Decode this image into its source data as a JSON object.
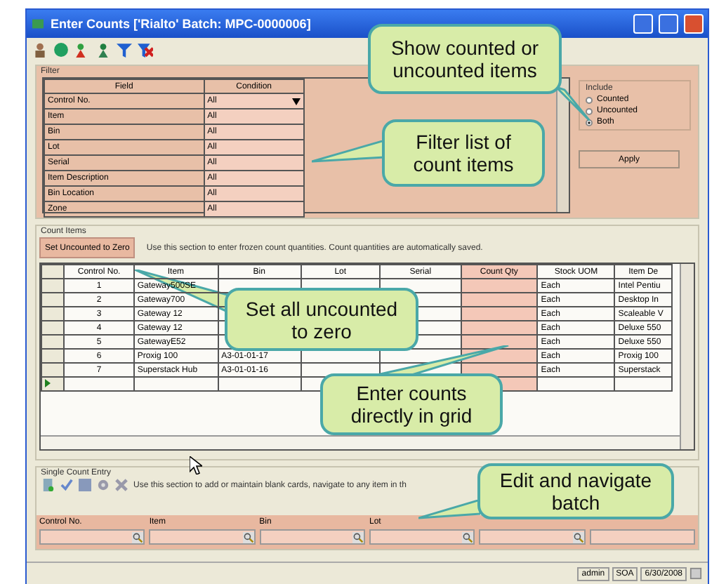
{
  "window": {
    "title": "Enter Counts ['Rialto' Batch: MPC-0000006]"
  },
  "filter": {
    "title": "Filter",
    "columns": [
      "Field",
      "Condition"
    ],
    "rows": [
      {
        "field": "Control No.",
        "condition": "All",
        "dropdown": true
      },
      {
        "field": "Item",
        "condition": "All",
        "dropdown": false
      },
      {
        "field": "Bin",
        "condition": "All",
        "dropdown": false
      },
      {
        "field": "Lot",
        "condition": "All",
        "dropdown": false
      },
      {
        "field": "Serial",
        "condition": "All",
        "dropdown": false
      },
      {
        "field": "Item Description",
        "condition": "All",
        "dropdown": false
      },
      {
        "field": "Bin Location",
        "condition": "All",
        "dropdown": false
      },
      {
        "field": "Zone",
        "condition": "All",
        "dropdown": false
      }
    ],
    "include": {
      "title": "Include",
      "options": [
        {
          "label": "Counted",
          "selected": false
        },
        {
          "label": "Uncounted",
          "selected": false
        },
        {
          "label": "Both",
          "selected": true
        }
      ]
    },
    "apply_button": "Apply"
  },
  "count_items": {
    "title": "Count Items",
    "button": "Set Uncounted to Zero",
    "hint": "Use this section to enter frozen count quantities. Count quantities are automatically saved.",
    "columns": [
      "Control No.",
      "Item",
      "Bin",
      "Lot",
      "Serial",
      "Count Qty",
      "Stock UOM",
      "Item De"
    ],
    "rows": [
      [
        "1",
        "Gateway500SE",
        "",
        "",
        "",
        "",
        "Each",
        "Intel Pentiu"
      ],
      [
        "2",
        "Gateway700",
        "",
        "",
        "",
        "",
        "Each",
        "Desktop In"
      ],
      [
        "3",
        "Gateway 12",
        "",
        "",
        "",
        "",
        "Each",
        "Scaleable V"
      ],
      [
        "4",
        "Gateway 12",
        "",
        "",
        "",
        "",
        "Each",
        "Deluxe 550"
      ],
      [
        "5",
        "GatewayE52",
        "",
        "",
        "",
        "",
        "Each",
        "Deluxe 550"
      ],
      [
        "6",
        "Proxig 100",
        "A3-01-01-17",
        "",
        "",
        "",
        "Each",
        "Proxig 100"
      ],
      [
        "7",
        "Superstack Hub",
        "A3-01-01-16",
        "",
        "",
        "",
        "Each",
        "Superstack"
      ]
    ]
  },
  "single_entry": {
    "title": "Single Count Entry",
    "hint": "Use this section to add or maintain blank cards, navigate to any item in th",
    "fields": [
      {
        "label": "Control No.",
        "lookup": true
      },
      {
        "label": "Item",
        "lookup": true
      },
      {
        "label": "Bin",
        "lookup": true
      },
      {
        "label": "Lot",
        "lookup": true
      },
      {
        "lookup": true
      },
      {
        "lookup": false
      }
    ]
  },
  "status_bar": [
    "admin",
    "SOA",
    "6/30/2008"
  ],
  "callouts": [
    {
      "text": "Show counted or uncounted items"
    },
    {
      "text": "Filter list of count items"
    },
    {
      "text": "Set all uncounted to zero"
    },
    {
      "text": "Enter counts directly in grid"
    },
    {
      "text": "Edit and navigate batch"
    }
  ]
}
